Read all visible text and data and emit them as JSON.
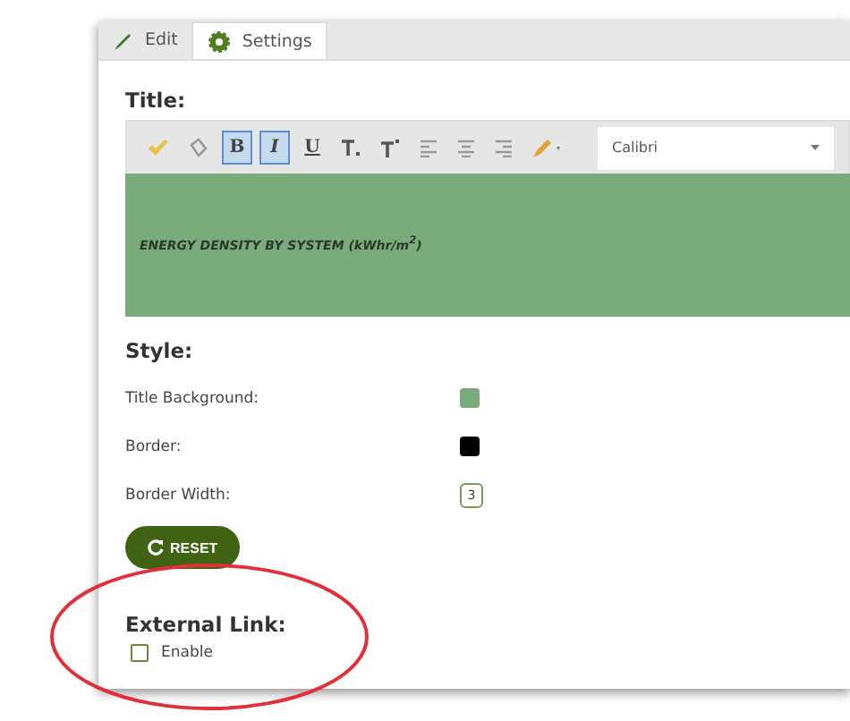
{
  "tabs": [
    {
      "label": "Edit",
      "selected": false
    },
    {
      "label": "Settings",
      "selected": true
    }
  ],
  "title_section": {
    "heading": "Title:",
    "toolbar": [
      {
        "kind": "icon",
        "active": false
      },
      {
        "kind": "icon",
        "active": false
      },
      {
        "kind": "text",
        "label": "B",
        "active": true
      },
      {
        "kind": "text",
        "label": "I",
        "active": true
      },
      {
        "kind": "text",
        "label": "U",
        "active": false
      },
      {
        "kind": "icon",
        "active": false
      },
      {
        "kind": "icon",
        "active": false
      },
      {
        "kind": "icon",
        "active": false
      },
      {
        "kind": "icon",
        "active": false
      },
      {
        "kind": "icon",
        "active": false
      },
      {
        "kind": "icon",
        "active": false
      }
    ],
    "font": "Calibri",
    "title_text": "ENERGY DENSITY BY SYSTEM (kWhr/m$^{2}$)"
  },
  "style_section": {
    "heading": "Style:",
    "rows": [
      {
        "kind": "swatch",
        "label": "Title Background:",
        "color": "#7aab7a"
      },
      {
        "kind": "swatch",
        "label": "Border:",
        "color": "#000000"
      },
      {
        "kind": "number",
        "label": "Border Width:",
        "value": "3"
      }
    ],
    "reset_button": "RESET"
  },
  "external_link": {
    "heading": "External Link:",
    "enable": {
      "label": "Enable",
      "checked": false
    }
  }
}
